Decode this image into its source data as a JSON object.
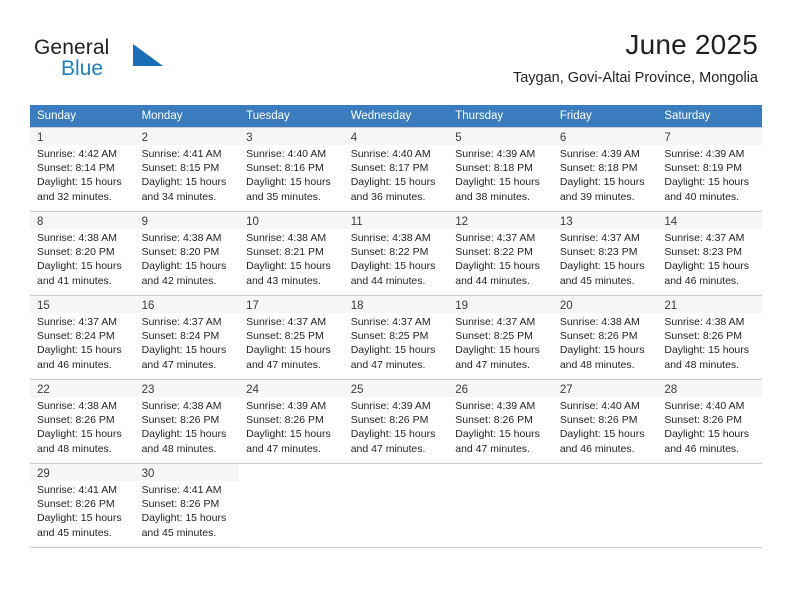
{
  "brand": {
    "word1": "General",
    "word2": "Blue",
    "triangle_icon": "triangle-logo-icon",
    "accent_color": "#1a6eb5"
  },
  "header": {
    "title": "June 2025",
    "subtitle": "Taygan, Govi-Altai Province, Mongolia"
  },
  "calendar": {
    "header_bg": "#3a7cbe",
    "weekday_headers": [
      "Sunday",
      "Monday",
      "Tuesday",
      "Wednesday",
      "Thursday",
      "Friday",
      "Saturday"
    ],
    "weeks": [
      [
        {
          "day": "1",
          "sunrise": "Sunrise: 4:42 AM",
          "sunset": "Sunset: 8:14 PM",
          "daylight1": "Daylight: 15 hours",
          "daylight2": "and 32 minutes."
        },
        {
          "day": "2",
          "sunrise": "Sunrise: 4:41 AM",
          "sunset": "Sunset: 8:15 PM",
          "daylight1": "Daylight: 15 hours",
          "daylight2": "and 34 minutes."
        },
        {
          "day": "3",
          "sunrise": "Sunrise: 4:40 AM",
          "sunset": "Sunset: 8:16 PM",
          "daylight1": "Daylight: 15 hours",
          "daylight2": "and 35 minutes."
        },
        {
          "day": "4",
          "sunrise": "Sunrise: 4:40 AM",
          "sunset": "Sunset: 8:17 PM",
          "daylight1": "Daylight: 15 hours",
          "daylight2": "and 36 minutes."
        },
        {
          "day": "5",
          "sunrise": "Sunrise: 4:39 AM",
          "sunset": "Sunset: 8:18 PM",
          "daylight1": "Daylight: 15 hours",
          "daylight2": "and 38 minutes."
        },
        {
          "day": "6",
          "sunrise": "Sunrise: 4:39 AM",
          "sunset": "Sunset: 8:18 PM",
          "daylight1": "Daylight: 15 hours",
          "daylight2": "and 39 minutes."
        },
        {
          "day": "7",
          "sunrise": "Sunrise: 4:39 AM",
          "sunset": "Sunset: 8:19 PM",
          "daylight1": "Daylight: 15 hours",
          "daylight2": "and 40 minutes."
        }
      ],
      [
        {
          "day": "8",
          "sunrise": "Sunrise: 4:38 AM",
          "sunset": "Sunset: 8:20 PM",
          "daylight1": "Daylight: 15 hours",
          "daylight2": "and 41 minutes."
        },
        {
          "day": "9",
          "sunrise": "Sunrise: 4:38 AM",
          "sunset": "Sunset: 8:20 PM",
          "daylight1": "Daylight: 15 hours",
          "daylight2": "and 42 minutes."
        },
        {
          "day": "10",
          "sunrise": "Sunrise: 4:38 AM",
          "sunset": "Sunset: 8:21 PM",
          "daylight1": "Daylight: 15 hours",
          "daylight2": "and 43 minutes."
        },
        {
          "day": "11",
          "sunrise": "Sunrise: 4:38 AM",
          "sunset": "Sunset: 8:22 PM",
          "daylight1": "Daylight: 15 hours",
          "daylight2": "and 44 minutes."
        },
        {
          "day": "12",
          "sunrise": "Sunrise: 4:37 AM",
          "sunset": "Sunset: 8:22 PM",
          "daylight1": "Daylight: 15 hours",
          "daylight2": "and 44 minutes."
        },
        {
          "day": "13",
          "sunrise": "Sunrise: 4:37 AM",
          "sunset": "Sunset: 8:23 PM",
          "daylight1": "Daylight: 15 hours",
          "daylight2": "and 45 minutes."
        },
        {
          "day": "14",
          "sunrise": "Sunrise: 4:37 AM",
          "sunset": "Sunset: 8:23 PM",
          "daylight1": "Daylight: 15 hours",
          "daylight2": "and 46 minutes."
        }
      ],
      [
        {
          "day": "15",
          "sunrise": "Sunrise: 4:37 AM",
          "sunset": "Sunset: 8:24 PM",
          "daylight1": "Daylight: 15 hours",
          "daylight2": "and 46 minutes."
        },
        {
          "day": "16",
          "sunrise": "Sunrise: 4:37 AM",
          "sunset": "Sunset: 8:24 PM",
          "daylight1": "Daylight: 15 hours",
          "daylight2": "and 47 minutes."
        },
        {
          "day": "17",
          "sunrise": "Sunrise: 4:37 AM",
          "sunset": "Sunset: 8:25 PM",
          "daylight1": "Daylight: 15 hours",
          "daylight2": "and 47 minutes."
        },
        {
          "day": "18",
          "sunrise": "Sunrise: 4:37 AM",
          "sunset": "Sunset: 8:25 PM",
          "daylight1": "Daylight: 15 hours",
          "daylight2": "and 47 minutes."
        },
        {
          "day": "19",
          "sunrise": "Sunrise: 4:37 AM",
          "sunset": "Sunset: 8:25 PM",
          "daylight1": "Daylight: 15 hours",
          "daylight2": "and 47 minutes."
        },
        {
          "day": "20",
          "sunrise": "Sunrise: 4:38 AM",
          "sunset": "Sunset: 8:26 PM",
          "daylight1": "Daylight: 15 hours",
          "daylight2": "and 48 minutes."
        },
        {
          "day": "21",
          "sunrise": "Sunrise: 4:38 AM",
          "sunset": "Sunset: 8:26 PM",
          "daylight1": "Daylight: 15 hours",
          "daylight2": "and 48 minutes."
        }
      ],
      [
        {
          "day": "22",
          "sunrise": "Sunrise: 4:38 AM",
          "sunset": "Sunset: 8:26 PM",
          "daylight1": "Daylight: 15 hours",
          "daylight2": "and 48 minutes."
        },
        {
          "day": "23",
          "sunrise": "Sunrise: 4:38 AM",
          "sunset": "Sunset: 8:26 PM",
          "daylight1": "Daylight: 15 hours",
          "daylight2": "and 48 minutes."
        },
        {
          "day": "24",
          "sunrise": "Sunrise: 4:39 AM",
          "sunset": "Sunset: 8:26 PM",
          "daylight1": "Daylight: 15 hours",
          "daylight2": "and 47 minutes."
        },
        {
          "day": "25",
          "sunrise": "Sunrise: 4:39 AM",
          "sunset": "Sunset: 8:26 PM",
          "daylight1": "Daylight: 15 hours",
          "daylight2": "and 47 minutes."
        },
        {
          "day": "26",
          "sunrise": "Sunrise: 4:39 AM",
          "sunset": "Sunset: 8:26 PM",
          "daylight1": "Daylight: 15 hours",
          "daylight2": "and 47 minutes."
        },
        {
          "day": "27",
          "sunrise": "Sunrise: 4:40 AM",
          "sunset": "Sunset: 8:26 PM",
          "daylight1": "Daylight: 15 hours",
          "daylight2": "and 46 minutes."
        },
        {
          "day": "28",
          "sunrise": "Sunrise: 4:40 AM",
          "sunset": "Sunset: 8:26 PM",
          "daylight1": "Daylight: 15 hours",
          "daylight2": "and 46 minutes."
        }
      ],
      [
        {
          "day": "29",
          "sunrise": "Sunrise: 4:41 AM",
          "sunset": "Sunset: 8:26 PM",
          "daylight1": "Daylight: 15 hours",
          "daylight2": "and 45 minutes."
        },
        {
          "day": "30",
          "sunrise": "Sunrise: 4:41 AM",
          "sunset": "Sunset: 8:26 PM",
          "daylight1": "Daylight: 15 hours",
          "daylight2": "and 45 minutes."
        },
        {
          "day": "",
          "sunrise": "",
          "sunset": "",
          "daylight1": "",
          "daylight2": ""
        },
        {
          "day": "",
          "sunrise": "",
          "sunset": "",
          "daylight1": "",
          "daylight2": ""
        },
        {
          "day": "",
          "sunrise": "",
          "sunset": "",
          "daylight1": "",
          "daylight2": ""
        },
        {
          "day": "",
          "sunrise": "",
          "sunset": "",
          "daylight1": "",
          "daylight2": ""
        },
        {
          "day": "",
          "sunrise": "",
          "sunset": "",
          "daylight1": "",
          "daylight2": ""
        }
      ]
    ]
  }
}
